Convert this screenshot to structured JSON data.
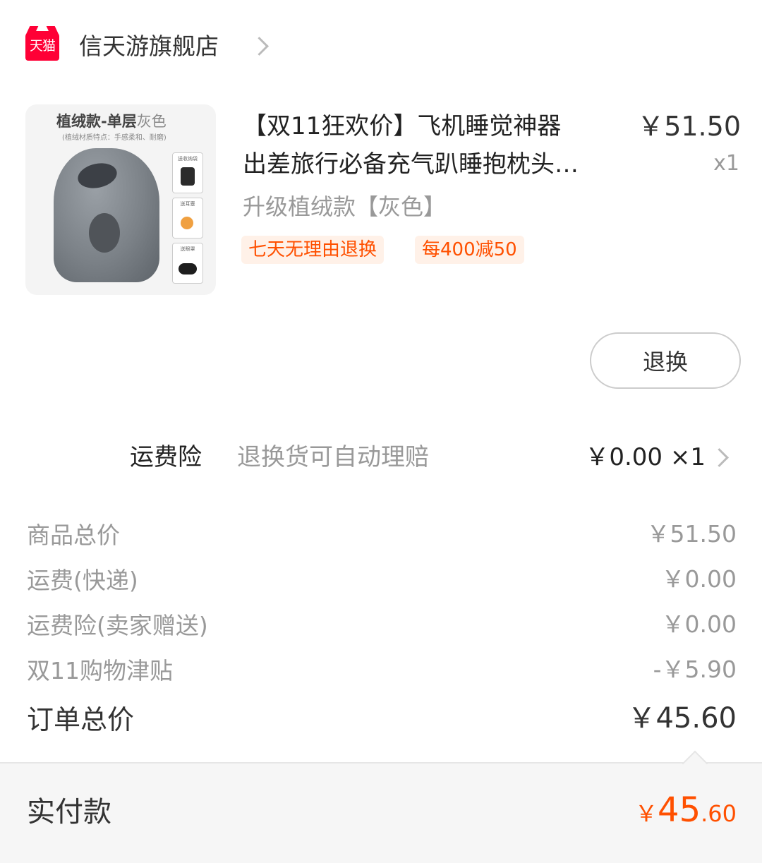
{
  "header": {
    "platform_badge": "天猫",
    "shop_name": "信天游旗舰店"
  },
  "product": {
    "image": {
      "title_main": "植绒款-单层",
      "title_color": "灰色",
      "subtitle": "(植绒材质特点：手感柔和、耐磨)",
      "gift_labels": [
        "送收纳袋",
        "送耳塞",
        "送眼罩"
      ]
    },
    "title_line1": "【双11狂欢价】飞机睡觉神器",
    "title_line2": "出差旅行必备充气趴睡抱枕头…",
    "price": "￥51.50",
    "quantity": "x1",
    "sku": "升级植绒款【灰色】",
    "tags": [
      "七天无理由退换",
      "每400减50"
    ],
    "return_button": "退换"
  },
  "insurance": {
    "label": "运费险",
    "description": "退换货可自动理赔",
    "price": "￥0.00 ×1"
  },
  "summary": [
    {
      "label": "商品总价",
      "value": "￥51.50"
    },
    {
      "label": "运费(快递)",
      "value": "￥0.00"
    },
    {
      "label": "运费险(卖家赠送)",
      "value": "￥0.00"
    },
    {
      "label": "双11购物津贴",
      "value": "-￥5.90"
    }
  ],
  "order_total": {
    "label": "订单总价",
    "value": "￥45.60"
  },
  "actual_payment": {
    "label": "实付款",
    "currency": "￥",
    "integer": "45",
    "decimal": ".60"
  },
  "colors": {
    "accent": "#ff5000",
    "tmall_red": "#ff0036"
  }
}
